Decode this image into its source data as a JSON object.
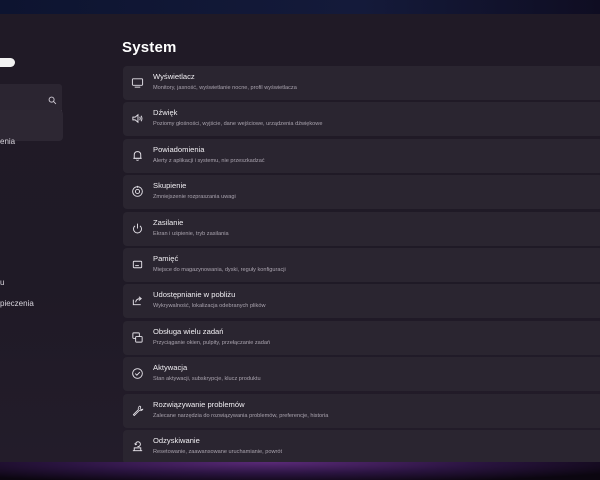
{
  "page": {
    "title": "System"
  },
  "sidebar": {
    "items": [
      {
        "label": "enia"
      },
      {
        "label": "u"
      },
      {
        "label": "pieczenia"
      }
    ]
  },
  "settings": [
    {
      "icon": "monitor-icon",
      "label": "Wyświetlacz",
      "desc": "Monitory, jasność, wyświetlanie nocne, profil wyświetlacza"
    },
    {
      "icon": "speaker-icon",
      "label": "Dźwięk",
      "desc": "Poziomy głośności, wyjście, dane wejściowe, urządzenia dźwiękowe"
    },
    {
      "icon": "bell-icon",
      "label": "Powiadomienia",
      "desc": "Alerty z aplikacji i systemu, nie przeszkadzać"
    },
    {
      "icon": "focus-icon",
      "label": "Skupienie",
      "desc": "Zmniejszenie rozpraszania uwagi"
    },
    {
      "icon": "power-icon",
      "label": "Zasilanie",
      "desc": "Ekran i uśpienie, tryb zasilania"
    },
    {
      "icon": "storage-icon",
      "label": "Pamięć",
      "desc": "Miejsce do magazynowania, dyski, reguły konfiguracji"
    },
    {
      "icon": "share-icon",
      "label": "Udostępnianie w pobliżu",
      "desc": "Wykrywalność, lokalizacja odebranych plików"
    },
    {
      "icon": "multitasking-icon",
      "label": "Obsługa wielu zadań",
      "desc": "Przyciąganie okien, pulpity, przełączanie zadań"
    },
    {
      "icon": "activation-icon",
      "label": "Aktywacja",
      "desc": "Stan aktywacji, subskrypcje, klucz produktu"
    },
    {
      "icon": "wrench-icon",
      "label": "Rozwiązywanie problemów",
      "desc": "Zalecane narzędzia do rozwiązywania problemów, preferencje, historia"
    },
    {
      "icon": "recovery-icon",
      "label": "Odzyskiwanie",
      "desc": "Resetowanie, zaawansowane uruchamianie, powrót"
    }
  ]
}
